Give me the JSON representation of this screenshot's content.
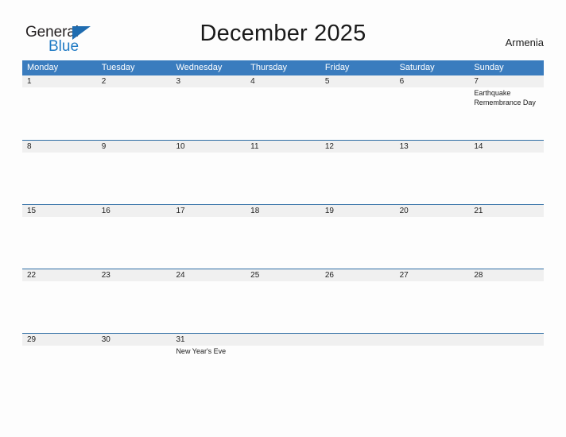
{
  "branding": {
    "name_part1": "General",
    "name_part2": "Blue",
    "flag_icon": "flag-triangle-icon",
    "accent_color": "#1f7ac4"
  },
  "header": {
    "title": "December 2025",
    "country": "Armenia"
  },
  "colors": {
    "weekday_header_bg": "#3a7cbe",
    "week_divider": "#2e6da4",
    "day_band_bg": "#f0f0f0",
    "page_bg": "#fdfdfd",
    "text": "#1a1a1a"
  },
  "calendar": {
    "weekdays": [
      "Monday",
      "Tuesday",
      "Wednesday",
      "Thursday",
      "Friday",
      "Saturday",
      "Sunday"
    ],
    "weeks": [
      [
        {
          "day": "1",
          "events": []
        },
        {
          "day": "2",
          "events": []
        },
        {
          "day": "3",
          "events": []
        },
        {
          "day": "4",
          "events": []
        },
        {
          "day": "5",
          "events": []
        },
        {
          "day": "6",
          "events": []
        },
        {
          "day": "7",
          "events": [
            "Earthquake Remembrance Day"
          ]
        }
      ],
      [
        {
          "day": "8",
          "events": []
        },
        {
          "day": "9",
          "events": []
        },
        {
          "day": "10",
          "events": []
        },
        {
          "day": "11",
          "events": []
        },
        {
          "day": "12",
          "events": []
        },
        {
          "day": "13",
          "events": []
        },
        {
          "day": "14",
          "events": []
        }
      ],
      [
        {
          "day": "15",
          "events": []
        },
        {
          "day": "16",
          "events": []
        },
        {
          "day": "17",
          "events": []
        },
        {
          "day": "18",
          "events": []
        },
        {
          "day": "19",
          "events": []
        },
        {
          "day": "20",
          "events": []
        },
        {
          "day": "21",
          "events": []
        }
      ],
      [
        {
          "day": "22",
          "events": []
        },
        {
          "day": "23",
          "events": []
        },
        {
          "day": "24",
          "events": []
        },
        {
          "day": "25",
          "events": []
        },
        {
          "day": "26",
          "events": []
        },
        {
          "day": "27",
          "events": []
        },
        {
          "day": "28",
          "events": []
        }
      ],
      [
        {
          "day": "29",
          "events": []
        },
        {
          "day": "30",
          "events": []
        },
        {
          "day": "31",
          "events": [
            "New Year's Eve"
          ]
        },
        {
          "day": "",
          "events": []
        },
        {
          "day": "",
          "events": []
        },
        {
          "day": "",
          "events": []
        },
        {
          "day": "",
          "events": []
        }
      ]
    ]
  }
}
